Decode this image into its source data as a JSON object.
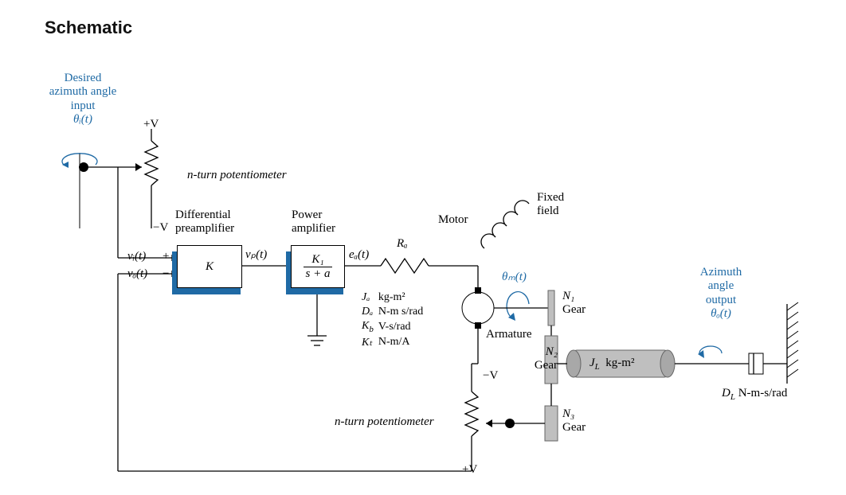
{
  "title": "Schematic",
  "input": {
    "line1": "Desired",
    "line2": "azimuth angle",
    "line3": "input",
    "symbol": "θᵢ(t)"
  },
  "pot": {
    "plusV": "+V",
    "minusV": "−V",
    "label": "n-turn potentiometer"
  },
  "sumjunction": {
    "vi": "vᵢ(t)",
    "vo": "vₒ(t)",
    "plus": "+",
    "minus": "−"
  },
  "diffamp": {
    "line1": "Differential",
    "line2": "preamplifier",
    "content": "K"
  },
  "vp": "vₚ(t)",
  "poweramp": {
    "line1": "Power",
    "line2": "amplifier",
    "num": "K₁",
    "den": "s + a"
  },
  "ea": "eₐ(t)",
  "Ra": "Rₐ",
  "motor": {
    "rows": [
      {
        "sym": "Jₐ",
        "unit": "kg-m²"
      },
      {
        "sym": "Dₐ",
        "unit": "N-m s/rad"
      },
      {
        "sym": "K_b",
        "unit": "V-s/rad"
      },
      {
        "sym": "Kₜ",
        "unit": "N-m/A"
      }
    ],
    "label": "Motor"
  },
  "fixedfield": {
    "l1": "Fixed",
    "l2": "field"
  },
  "thetam": "θₘ(t)",
  "armature": "Armature",
  "gears": {
    "n1": "N₁",
    "g": "Gear",
    "n2": "N₂",
    "n3": "N₃"
  },
  "load": {
    "JL": "J_L",
    "JLunit": "kg-m²",
    "DL": "D_L",
    "DLunit": "N-m-s/rad"
  },
  "output": {
    "l1": "Azimuth",
    "l2": "angle",
    "l3": "output",
    "sym": "θₒ(t)"
  },
  "feedbackPot": {
    "label": "n-turn potentiometer",
    "minusV": "−V",
    "plusV": "+V"
  }
}
